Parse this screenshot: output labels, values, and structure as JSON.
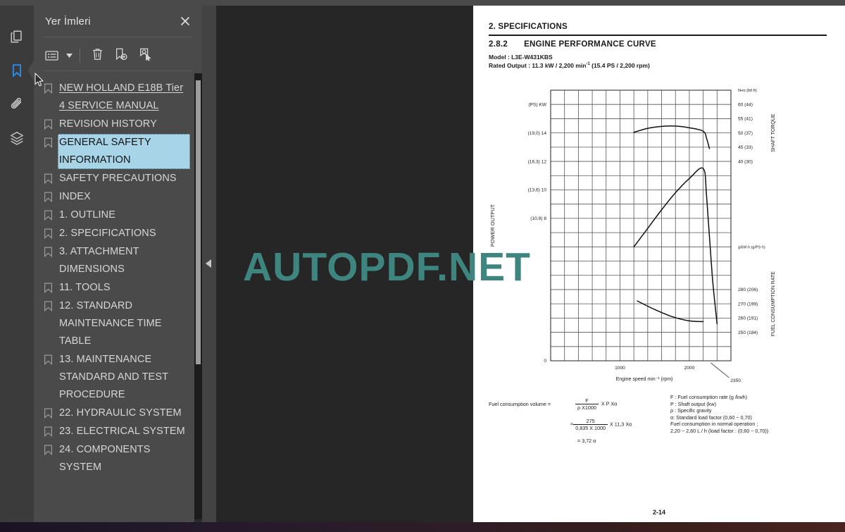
{
  "window": {
    "accent_blue": "#2b8ceb",
    "panel_bg": "#4a4a4a",
    "rail_bg": "#3b3b3b",
    "viewer_bg": "#262626",
    "watermark_color": "#3e857f"
  },
  "rail": {
    "items": [
      {
        "icon": "pages-thumbnail-icon",
        "name": "rail-item-page-thumbnails",
        "active": false
      },
      {
        "icon": "bookmark-icon",
        "name": "rail-item-bookmarks",
        "active": true
      },
      {
        "icon": "paperclip-icon",
        "name": "rail-item-attachments",
        "active": false
      },
      {
        "icon": "layers-icon",
        "name": "rail-item-layers",
        "active": false
      }
    ]
  },
  "panel": {
    "title": "Yer İmleri",
    "close_label": "×",
    "toolbar": {
      "options_label": "list-options",
      "delete_label": "delete-bookmark",
      "new_label": "new-bookmark",
      "set_destination_label": "set-bookmark-destination"
    },
    "bookmarks": [
      {
        "label": "NEW HOLLAND E18B Tier 4 SERVICE MANUAL",
        "root": true,
        "selected": false
      },
      {
        "label": "REVISION HISTORY",
        "root": false,
        "selected": false
      },
      {
        "label": "GENERAL SAFETY INFORMATION",
        "root": false,
        "selected": true
      },
      {
        "label": "SAFETY PRECAUTIONS",
        "root": false,
        "selected": false
      },
      {
        "label": "INDEX",
        "root": false,
        "selected": false
      },
      {
        "label": "1. OUTLINE",
        "root": false,
        "selected": false
      },
      {
        "label": "2. SPECIFICATIONS",
        "root": false,
        "selected": false
      },
      {
        "label": "3. ATTACHMENT DIMENSIONS",
        "root": false,
        "selected": false
      },
      {
        "label": "11. TOOLS",
        "root": false,
        "selected": false
      },
      {
        "label": "12. STANDARD MAINTENANCE TIME TABLE",
        "root": false,
        "selected": false
      },
      {
        "label": "13. MAINTENANCE STANDARD AND TEST PROCEDURE",
        "root": false,
        "selected": false
      },
      {
        "label": "22. HYDRAULIC SYSTEM",
        "root": false,
        "selected": false
      },
      {
        "label": "23. ELECTRICAL SYSTEM",
        "root": false,
        "selected": false
      },
      {
        "label": "24. COMPONENTS SYSTEM",
        "root": false,
        "selected": false
      }
    ]
  },
  "viewer": {
    "watermark": "AUTOPDF.NET",
    "collapse_handle": "collapse-sidebar"
  },
  "document": {
    "section_title": "2.  SPECIFICATIONS",
    "subsection_number": "2.8.2",
    "subsection_title": "ENGINE PERFORMANCE CURVE",
    "model_line": "Model : L3E-W431KBS",
    "rated_output_prefix": "Rated Output : 11.3 kW / 2,200 min",
    "rated_output_sup": "-1",
    "rated_output_suffix": " (15.4 PS / 2,200 rpm)",
    "page_number": "2-14",
    "formula": {
      "lhs": "Fuel consumption volume =",
      "f1_num": "F",
      "f1_den": "ρ X1000",
      "f1_tail": "X P Xα",
      "eq2": "=",
      "f2_num": "275",
      "f2_den": "0,835 X 1000",
      "f2_tail": "X 11,3 Xα",
      "result": "= 3,72 α"
    },
    "legend": [
      "F : Fuel consumption rate (g /kwh)",
      "P : Shaft output (kw)",
      "ρ : Specific gravity",
      "α: Standard load factor (0,60 ~ 0,70)",
      "Fuel consumption in normal operation ;",
      "2,20 ~ 2,60 L / h (load factor : (0,60 ~ 0,70))"
    ]
  },
  "chart_data": {
    "type": "line",
    "title": "ENGINE PERFORMANCE CURVE",
    "xlabel": "Engine speed   min⁻¹ (rpm)",
    "x": {
      "min": 0,
      "max": 2600,
      "ticks": [
        1000,
        2000
      ],
      "gridstep": 200
    },
    "annotations": [
      {
        "text": "2350",
        "x": 2350
      }
    ],
    "axes": [
      {
        "name": "POWER OUTPUT",
        "unit_header": "(PS)  KW",
        "ticks": [
          {
            "label": "(19,0) 14",
            "kw": 14,
            "ps": 19.0
          },
          {
            "label": "(16,3) 12",
            "kw": 12,
            "ps": 16.3
          },
          {
            "label": "(13,6) 10",
            "kw": 10,
            "ps": 13.6
          },
          {
            "label": "(10,9)  8",
            "kw": 8,
            "ps": 10.9
          },
          {
            "label": "0",
            "kw": 0,
            "ps": 0
          }
        ],
        "side": "left"
      },
      {
        "name": "SHAFT TORQUE",
        "unit_header": "N•m (lbf·ft)",
        "ticks": [
          {
            "label": "60 (44)",
            "nm": 60,
            "lbfft": 44
          },
          {
            "label": "55 (41)",
            "nm": 55,
            "lbfft": 41
          },
          {
            "label": "50 (37)",
            "nm": 50,
            "lbfft": 37
          },
          {
            "label": "45 (33)",
            "nm": 45,
            "lbfft": 33
          },
          {
            "label": "40 (30)",
            "nm": 40,
            "lbfft": 30
          }
        ],
        "side": "right"
      },
      {
        "name": "FUEL CONSUMPTION RATE",
        "unit_header": "g/kW·h (g/PS·h)",
        "ticks": [
          {
            "label": "280 (206)",
            "gkwh": 280,
            "gpsh": 206
          },
          {
            "label": "270 (199)",
            "gkwh": 270,
            "gpsh": 199
          },
          {
            "label": "260 (191)",
            "gkwh": 260,
            "gpsh": 191
          },
          {
            "label": "250 (184)",
            "gkwh": 250,
            "gpsh": 184
          }
        ],
        "side": "right"
      }
    ],
    "series": [
      {
        "name": "Shaft torque",
        "axis": "SHAFT TORQUE",
        "points": [
          [
            1200,
            50.2
          ],
          [
            1400,
            51.6
          ],
          [
            1600,
            52.3
          ],
          [
            1800,
            52.4
          ],
          [
            2000,
            51.8
          ],
          [
            2200,
            50.6
          ],
          [
            2250,
            48.0
          ],
          [
            2290,
            44.5
          ]
        ]
      },
      {
        "name": "Power output",
        "axis": "POWER OUTPUT",
        "points": [
          [
            1200,
            6.0
          ],
          [
            1400,
            7.3
          ],
          [
            1600,
            8.6
          ],
          [
            1800,
            9.8
          ],
          [
            2000,
            10.8
          ],
          [
            2200,
            11.5
          ],
          [
            2250,
            9.5
          ],
          [
            2330,
            4.0
          ],
          [
            2400,
            0.6
          ]
        ]
      },
      {
        "name": "Fuel consumption rate",
        "axis": "FUEL CONSUMPTION RATE",
        "points": [
          [
            1250,
            272
          ],
          [
            1500,
            266
          ],
          [
            1750,
            261
          ],
          [
            2000,
            258
          ],
          [
            2200,
            257.5
          ]
        ]
      }
    ]
  }
}
